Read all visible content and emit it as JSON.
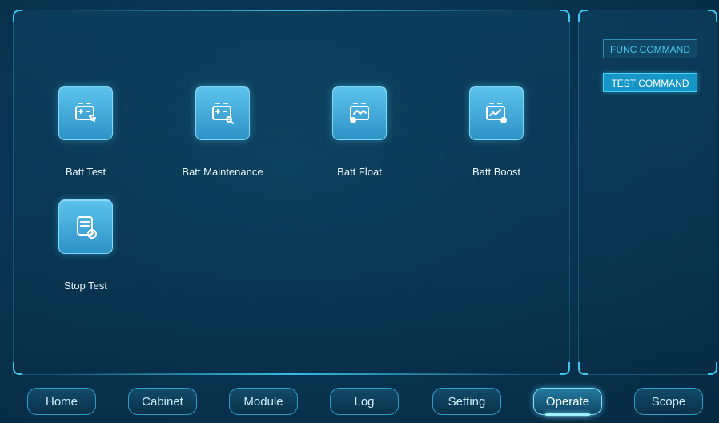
{
  "commands": {
    "func_label": "FUNC COMMAND",
    "test_label": "TEST COMMAND",
    "active": "test"
  },
  "tiles": [
    {
      "label": "Batt Test",
      "icon": "battery-wrench-icon"
    },
    {
      "label": "Batt Maintenance",
      "icon": "battery-search-icon"
    },
    {
      "label": "Batt Float",
      "icon": "battery-float-icon"
    },
    {
      "label": "Batt Boost",
      "icon": "battery-boost-icon"
    },
    {
      "label": "Stop Test",
      "icon": "document-stop-icon"
    }
  ],
  "nav": [
    {
      "label": "Home"
    },
    {
      "label": "Cabinet"
    },
    {
      "label": "Module"
    },
    {
      "label": "Log"
    },
    {
      "label": "Setting"
    },
    {
      "label": "Operate",
      "active": true
    },
    {
      "label": "Scope"
    }
  ],
  "colors": {
    "accent": "#3fc6ef",
    "active_button": "#1596c6",
    "background": "#0a3552"
  }
}
